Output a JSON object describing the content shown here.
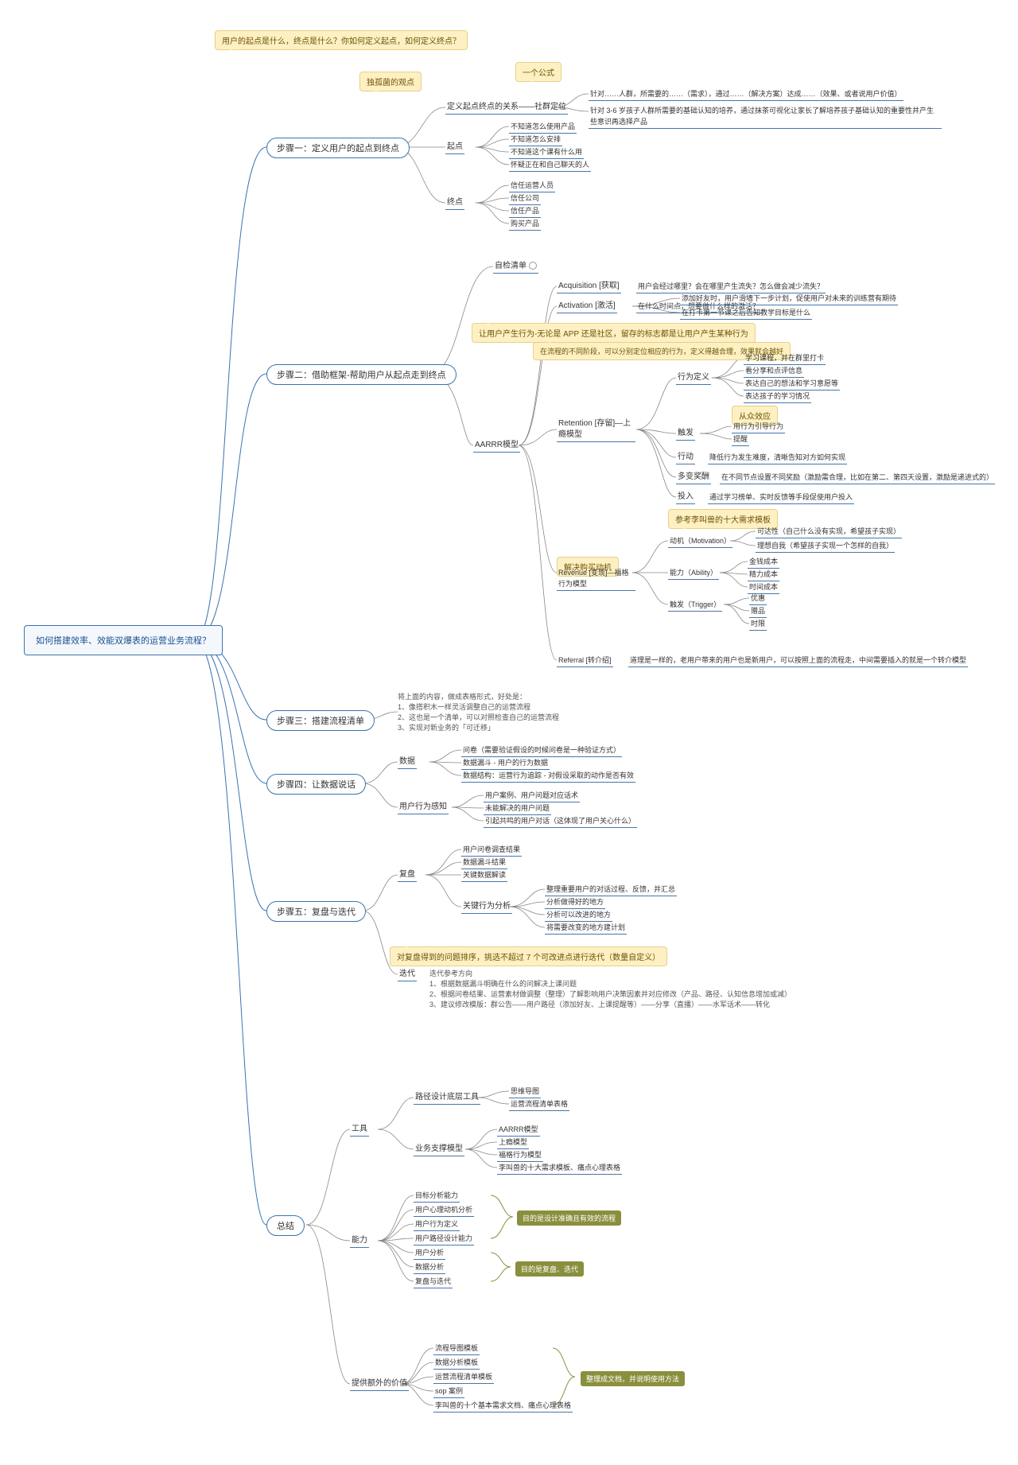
{
  "root": "如何搭建效率、效能双爆表的运营业务流程？",
  "callouts": {
    "c_start": "用户的起点是什么，终点是什么？你如何定义起点，如何定义终点？",
    "c_opinion": "独孤菌的观点",
    "c_formula": "一个公式",
    "c_retain": "让用户产生行为-无论是 APP 还是社区，留存的标志都是让用户产生某种行为",
    "c_stage": "在流程的不同阶段，可以分别定位相应的行为，定义得越合理，效果就会越好",
    "c_crowd": "从众效应",
    "c_needs": "参考李叫兽的十大需求模板",
    "c_motive": "解决购买动机",
    "c_review": "对复盘得到的问题排序，挑选不超过 7 个可改进点进行迭代（数量自定义）"
  },
  "step1": {
    "title": "步骤一：定义用户的起点到终点",
    "l1": "定义起点终点的关系——社群定位",
    "l1a": "针对……人群，所需要的……（需求），通过……（解决方案）达成……（效果、或者说用户价值）",
    "l1b": "针对 3-6 岁孩子人群所需要的基础认知的培养，通过抹茶可视化让家长了解培养孩子基础认知的重要性并产生些意识再选择产品",
    "start": "起点",
    "start_items": [
      "不知道怎么使用产品",
      "不知道怎么安排",
      "不知道这个课有什么用",
      "怀疑正在和自己聊天的人"
    ],
    "end": "终点",
    "end_items": [
      "信任运营人员",
      "信任公司",
      "信任产品",
      "购买产品"
    ]
  },
  "step2": {
    "title": "步骤二：借助框架-帮助用户从起点走到终点",
    "check": "自检清单",
    "model": "AARRR模型",
    "acq": "Acquisition [获取]",
    "acq_t": "用户会经过哪里？会在哪里产生流失？怎么做会减少流失？",
    "act": "Activation [激活]",
    "act_t": "在什么时间点，想要做什么样的激活？",
    "act_a": "添加好友时，用户滑墙下一步计划，促使用户对未来的训练营有期待",
    "act_b": "在打卡第一节课之后告知教学目标是什么",
    "ret": "Retention [存留]—上瘾模型",
    "bdef": "行为定义",
    "bdef_items": [
      "学习课程，并在群里打卡",
      "看分享和点评信息",
      "表达自己的想法和学习意愿等",
      "表达孩子的学习情况"
    ],
    "trig": "触发",
    "trig_items": [
      "用行为引导行为",
      "提醒"
    ],
    "act2": "行动",
    "act2_t": "降低行为发生难度，清晰告知对方如何实现",
    "reward": "多变奖酬",
    "reward_t": "在不同节点设置不同奖励（激励需合理，比如在第二、第四天设置，激励是递进式的）",
    "invest": "投入",
    "invest_t": "通过学习榜单、实时反馈等手段促使用户投入",
    "rev": "Revenue [变现]—福格行为模型",
    "mot": "动机（Motivation）",
    "mot_items": [
      "可达性（自己什么没有实现，希望孩子实现）",
      "理想自我（希望孩子实现一个怎样的自我）"
    ],
    "abi": "能力（Ability）",
    "abi_items": [
      "金钱成本",
      "精力成本",
      "时间成本"
    ],
    "tri": "触发（Trigger）",
    "tri_items": [
      "优惠",
      "赠品",
      "时限"
    ],
    "ref": "Referral [转介绍]",
    "ref_t": "道理是一样的，老用户带来的用户也是新用户，可以按照上面的流程走，中间需要插入的就是一个转介模型"
  },
  "step3": {
    "title": "步骤三：搭建流程清单",
    "body": "将上面的内容，做成表格形式，好处是：\n1、像搭积木一样灵活调整自己的运营流程\n2、这也是一个清单，可以对照检查自己的运营流程\n3、实现对新业务的「可迁移」"
  },
  "step4": {
    "title": "步骤四：让数据说话",
    "data": "数据",
    "data_items": [
      "问卷（需要验证假设的时候问卷是一种验证方式）",
      "数据漏斗 - 用户的行为数据",
      "数据结构：运营行为追踪 - 对假设采取的动作是否有效"
    ],
    "ub": "用户行为感知",
    "ub_items": [
      "用户案例、用户问题对应话术",
      "未能解决的用户问题",
      "引起共鸣的用户对话（这体现了用户关心什么）"
    ]
  },
  "step5": {
    "title": "步骤五：复盘与迭代",
    "review": "复盘",
    "rev_items": [
      "用户问卷调查结果",
      "数据漏斗结果",
      "关键数据解读"
    ],
    "kb": "关键行为分析",
    "kb_items": [
      "整理重要用户的对话过程、反馈，并汇总",
      "分析做得好的地方",
      "分析可以改进的地方",
      "将需要改变的地方建计划"
    ],
    "iter": "迭代",
    "iter_body": "迭代参考方向\n1、根据数据漏斗明确在什么的问解决上课问题\n2、根据问卷结果、运营素材做调整（整理）了解影响用户决策因素并对应修改（产品、路径、认知信息增加或减）\n3、建议修改模版：群公告——用户路径（添加好友、上课提醒等）——分享（直播）——水军话术——转化"
  },
  "summary": {
    "title": "总结",
    "tools": "工具",
    "t1": "路径设计底层工具",
    "t1_items": [
      "思维导图",
      "运营流程清单表格"
    ],
    "t2": "业务支撑模型",
    "t2_items": [
      "AARRR模型",
      "上瘾模型",
      "福格行为模型",
      "李叫兽的十大需求模板、痛点心理表格"
    ],
    "ability": "能力",
    "ab_items": [
      "目标分析能力",
      "用户心理动机分析",
      "用户行为定义",
      "用户路径设计能力",
      "用户分析",
      "数据分析",
      "复盘与迭代"
    ],
    "ab_note1": "目的是设计准确且有效的流程",
    "ab_note2": "目的是复盘、迭代",
    "extra": "提供额外的价值",
    "ex_items": [
      "流程导图模板",
      "数据分析模板",
      "运营流程清单模板",
      "sop 案例",
      "李叫兽的十个基本需求文档、痛点心理表格"
    ],
    "ex_note": "整理成文档，并说明使用方法"
  }
}
